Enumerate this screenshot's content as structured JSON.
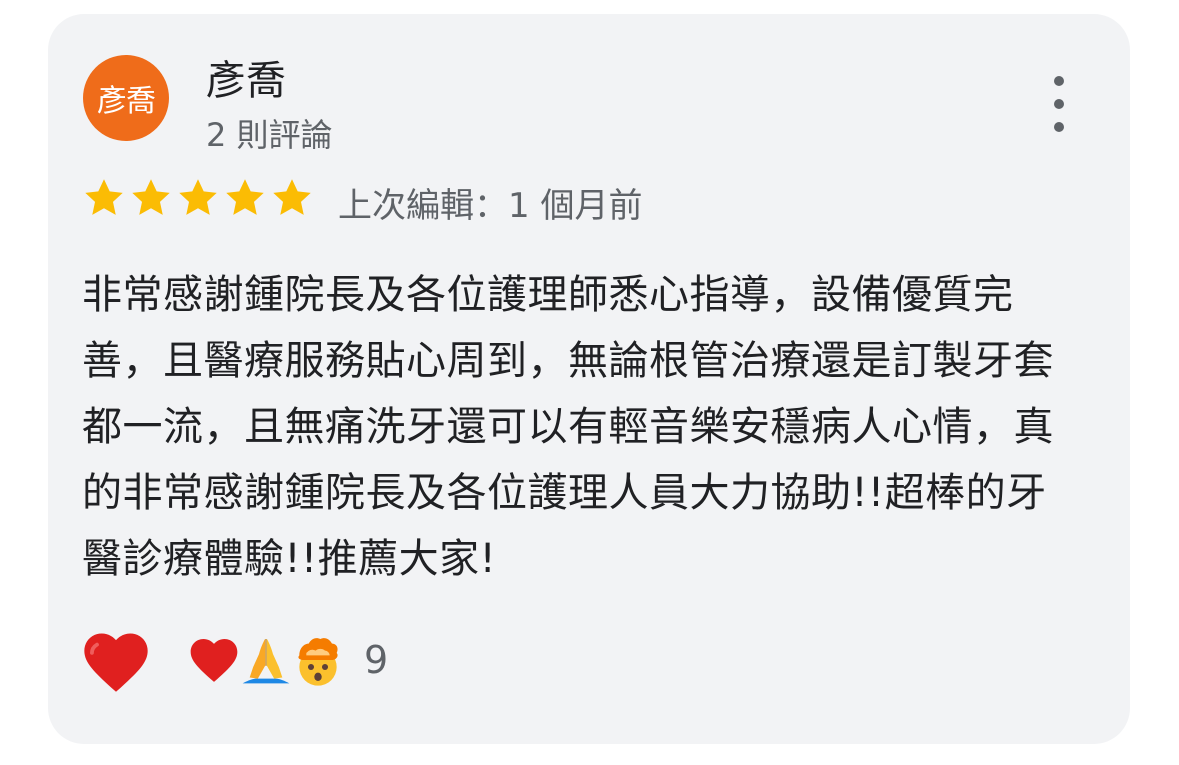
{
  "reviewer": {
    "avatar_text": "彥喬",
    "name": "彥喬",
    "review_count": "2 則評論"
  },
  "rating": {
    "stars": 5,
    "max": 5,
    "edited": "上次編輯：1 個月前"
  },
  "review": {
    "text": "非常感謝鍾院長及各位護理師悉心指導，設備優質完善，且醫療服務貼心周到，無論根管治療還是訂製牙套都一流，且無痛洗牙還可以有輕音樂安穩病人心情，真的非常感謝鍾院長及各位護理人員大力協助!!超棒的牙醫診療體驗!!推薦大家!"
  },
  "reactions": {
    "count": "9",
    "icons": [
      "red-heart-icon",
      "praying-hands-icon",
      "exploding-head-icon"
    ]
  },
  "colors": {
    "avatar_bg": "#ef6c1a",
    "star": "#fbbc04",
    "card_bg": "#f2f3f5",
    "heart": "#e0201f"
  }
}
